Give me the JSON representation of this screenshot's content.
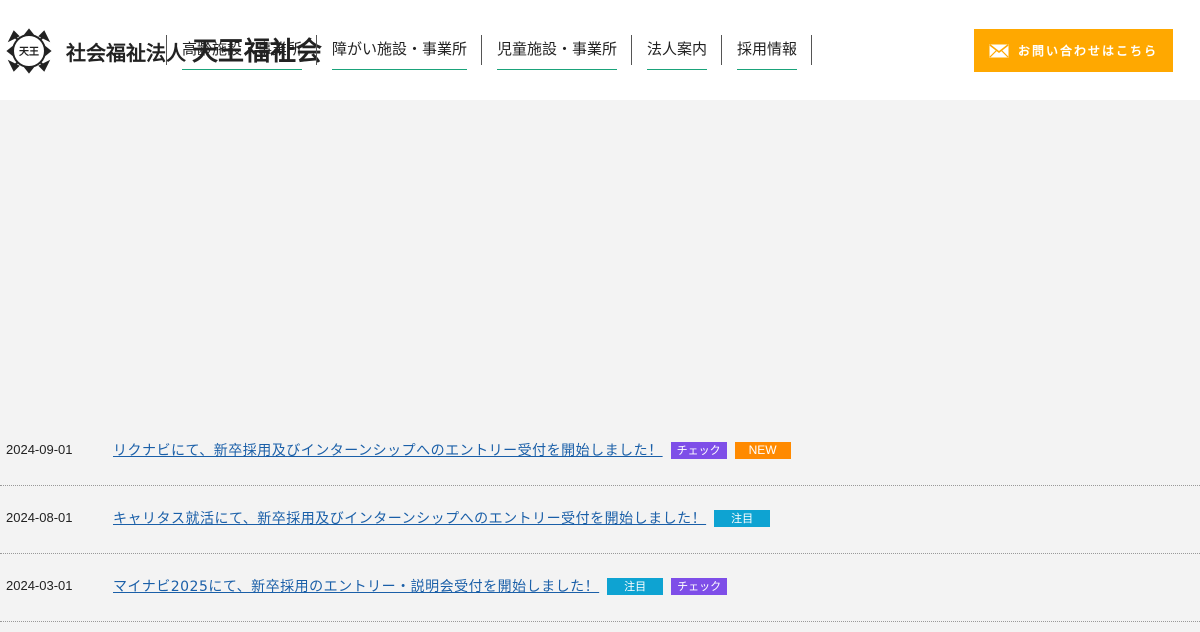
{
  "header": {
    "logo_corp": "社会福祉法人",
    "logo_name": "天王福祉会",
    "logo_mark_text": "天王",
    "nav": [
      {
        "label": "高齢施設・事業所"
      },
      {
        "label": "障がい施設・事業所"
      },
      {
        "label": "児童施設・事業所"
      },
      {
        "label": "法人案内"
      },
      {
        "label": "採用情報"
      }
    ],
    "contact_label": "お問い合わせはこちら"
  },
  "colors": {
    "accent_orange": "#ffa800",
    "nav_underline": "#1aa37a",
    "tag_check": "#7e4ee8",
    "tag_new": "#ff8a00",
    "tag_attention": "#0ea3d2",
    "link": "#1a5fa8"
  },
  "news": [
    {
      "date": "2024-09-01",
      "title": "リクナビにて、新卒採用及びインターンシップへのエントリー受付を開始しました！",
      "tags": [
        {
          "label": "チェック",
          "kind": "check"
        },
        {
          "label": "NEW",
          "kind": "new"
        }
      ]
    },
    {
      "date": "2024-08-01",
      "title": "キャリタス就活にて、新卒採用及びインターンシップへのエントリー受付を開始しました！",
      "tags": [
        {
          "label": "注目",
          "kind": "attention"
        }
      ]
    },
    {
      "date": "2024-03-01",
      "title": "マイナビ2025にて、新卒採用のエントリー・説明会受付を開始しました！",
      "tags": [
        {
          "label": "注目",
          "kind": "attention"
        },
        {
          "label": "チェック",
          "kind": "check"
        }
      ]
    }
  ]
}
